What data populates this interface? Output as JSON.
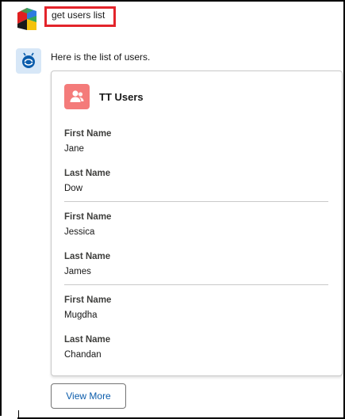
{
  "user_message": {
    "text": "get users list"
  },
  "bot_message": {
    "text": "Here is the list of users."
  },
  "card": {
    "title": "TT Users",
    "icon": "users-icon",
    "icon_color": "#f47b7a",
    "records": [
      {
        "first_label": "First Name",
        "first_value": "Jane",
        "last_label": "Last Name",
        "last_value": "Dow"
      },
      {
        "first_label": "First Name",
        "first_value": "Jessica",
        "last_label": "Last Name",
        "last_value": "James"
      },
      {
        "first_label": "First Name",
        "first_value": "Mugdha",
        "last_label": "Last Name",
        "last_value": "Chandan"
      }
    ]
  },
  "view_more": {
    "label": "View More"
  },
  "colors": {
    "highlight_border": "#e3242b",
    "bot_avatar_bg": "#d7e7f7",
    "link_blue": "#0b5cab"
  }
}
